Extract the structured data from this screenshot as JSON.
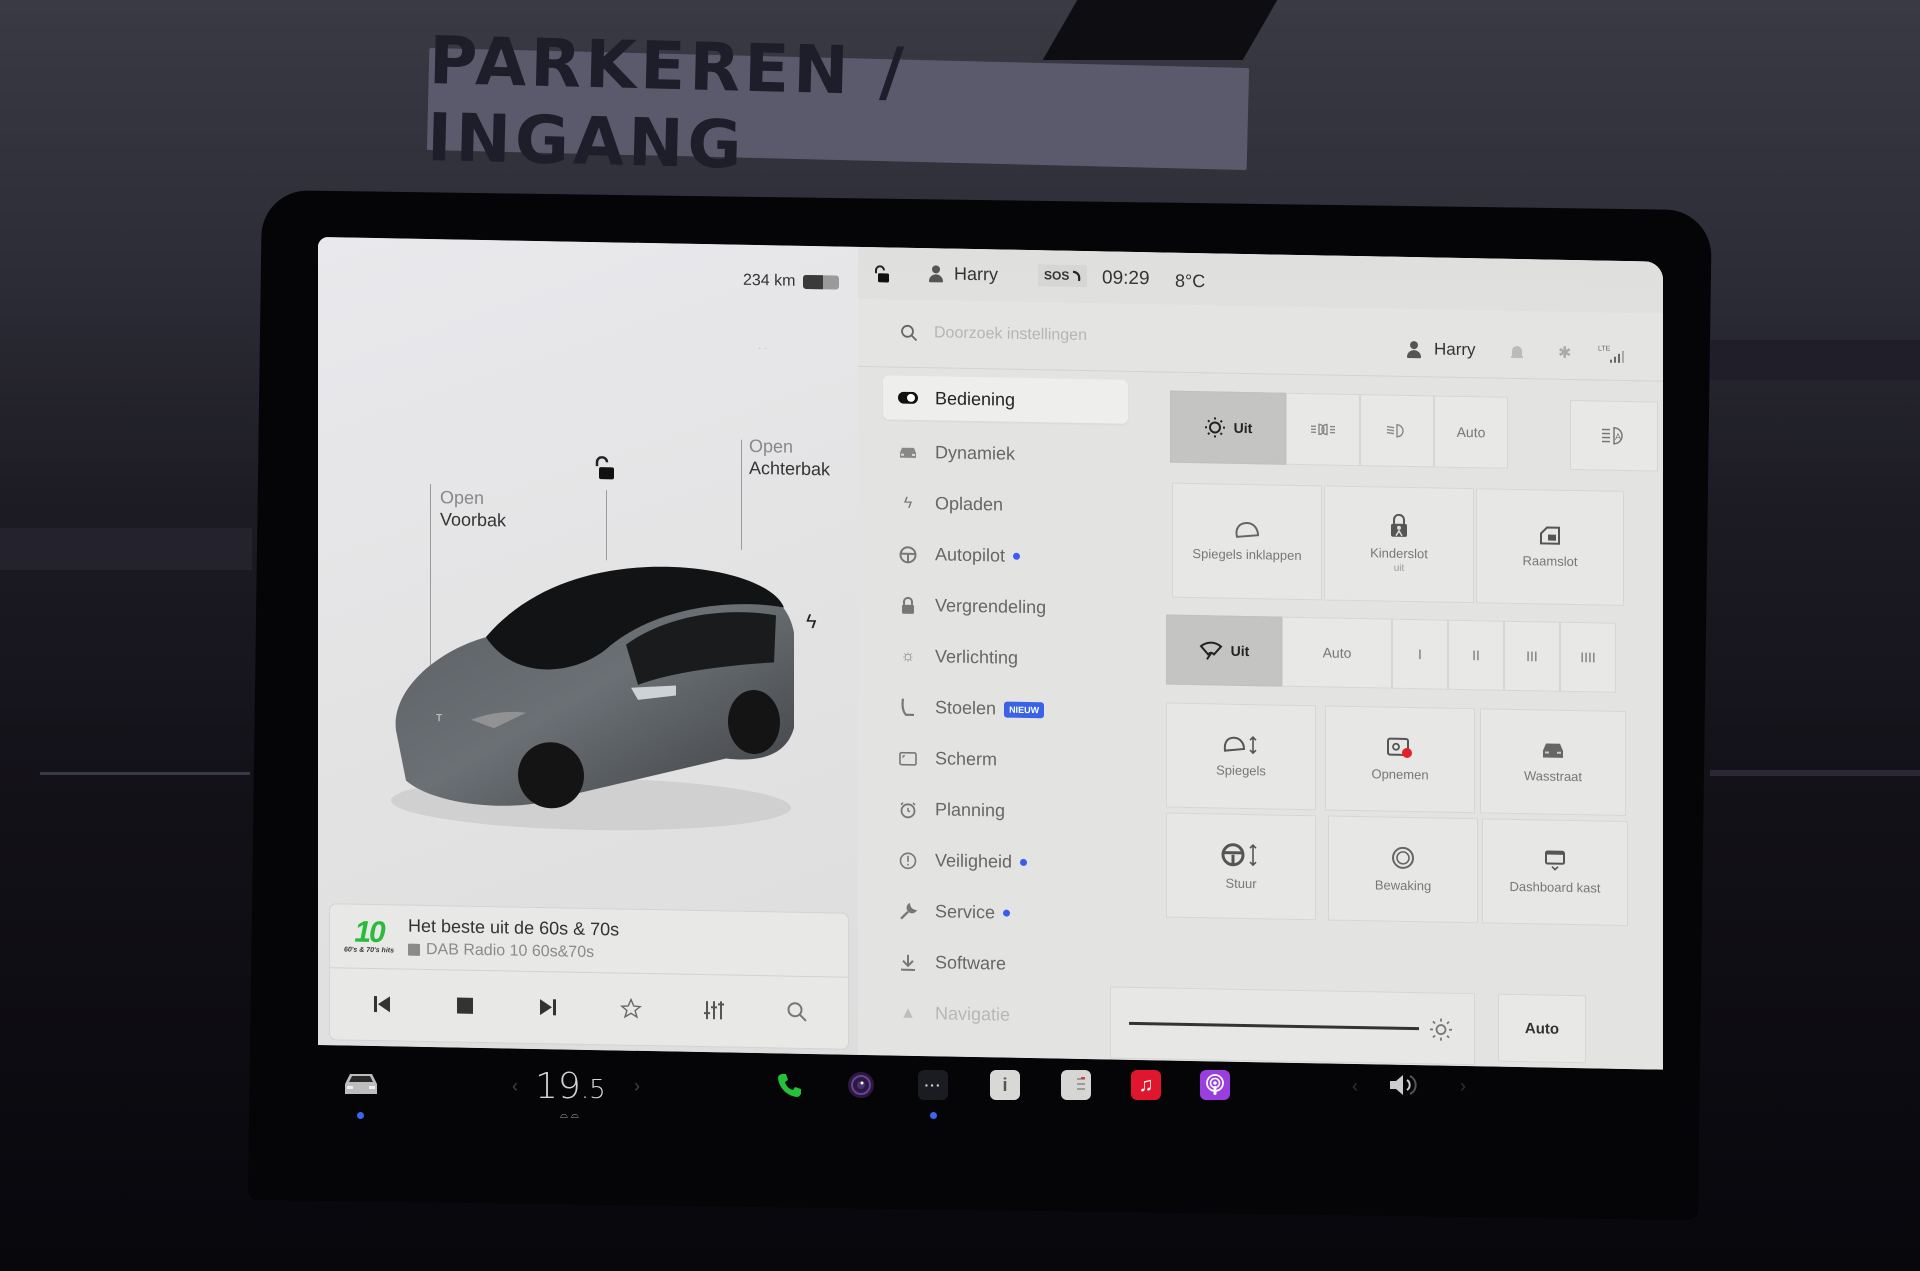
{
  "scene": {
    "sign_text": "PARKEREN / INGANG"
  },
  "car_pane": {
    "range": "234 km",
    "battery_level_percent": 55,
    "frunk": {
      "action": "Open",
      "target": "Voorbak"
    },
    "trunk": {
      "action": "Open",
      "target": "Achterbak"
    },
    "lock_state": "unlocked",
    "charge_port_icon": "lightning-bolt-icon"
  },
  "media": {
    "station_logo_number": "10",
    "station_logo_tagline": "60's & 70's hits",
    "title": "Het beste uit de 60s & 70s",
    "source": "DAB Radio 10 60s&70s",
    "controls": [
      "previous",
      "stop",
      "next",
      "favorite",
      "equalizer",
      "search"
    ]
  },
  "status_bar": {
    "user": "Harry",
    "sos": "SOS",
    "time": "09:29",
    "temperature": "8°C"
  },
  "settings_header": {
    "search_placeholder": "Doorzoek instellingen",
    "user": "Harry",
    "lte_label": "LTE"
  },
  "menu": {
    "items": [
      {
        "label": "Bediening",
        "icon": "toggle-icon",
        "active": true
      },
      {
        "label": "Dynamiek",
        "icon": "car-front-icon"
      },
      {
        "label": "Opladen",
        "icon": "lightning-icon"
      },
      {
        "label": "Autopilot",
        "icon": "steering-wheel-icon",
        "dot": true
      },
      {
        "label": "Vergrendeling",
        "icon": "lock-icon"
      },
      {
        "label": "Verlichting",
        "icon": "light-bulb-icon"
      },
      {
        "label": "Stoelen",
        "icon": "seat-icon",
        "badge": "NIEUW"
      },
      {
        "label": "Scherm",
        "icon": "display-icon"
      },
      {
        "label": "Planning",
        "icon": "alarm-clock-icon"
      },
      {
        "label": "Veiligheid",
        "icon": "alert-circle-icon",
        "dot": true
      },
      {
        "label": "Service",
        "icon": "wrench-icon",
        "dot": true
      },
      {
        "label": "Software",
        "icon": "download-icon"
      },
      {
        "label": "Navigatie",
        "icon": "navigation-icon"
      }
    ]
  },
  "controls": {
    "lights": {
      "options": [
        "Uit",
        "",
        "",
        "Auto"
      ],
      "selected": "Uit",
      "auto_high_beam_icon": "auto-high-beam-icon"
    },
    "tiles_row1": [
      {
        "label": "Spiegels inklappen",
        "sub": ""
      },
      {
        "label": "Kinderslot",
        "sub": "uit"
      },
      {
        "label": "Raamslot",
        "sub": ""
      }
    ],
    "wipers": {
      "options": [
        "Uit",
        "Auto",
        "I",
        "II",
        "III",
        "IIII"
      ],
      "selected": "Uit"
    },
    "tiles_row2": [
      {
        "label": "Spiegels"
      },
      {
        "label": "Opnemen"
      },
      {
        "label": "Wasstraat"
      }
    ],
    "tiles_row3": [
      {
        "label": "Stuur"
      },
      {
        "label": "Bewaking"
      },
      {
        "label": "Dashboard kast"
      }
    ],
    "brightness": {
      "level_percent": 100,
      "auto_label": "Auto"
    }
  },
  "taskbar": {
    "cabin_temperature_int": "19",
    "cabin_temperature_dec": ".5",
    "apps": [
      "phone",
      "camera",
      "more",
      "manual",
      "release-notes",
      "music",
      "podcasts"
    ],
    "colors": {
      "phone": "#22c23a",
      "music": "#e0162e",
      "podcasts": "#9a3ee0",
      "indicator": "#3a66f4"
    }
  }
}
